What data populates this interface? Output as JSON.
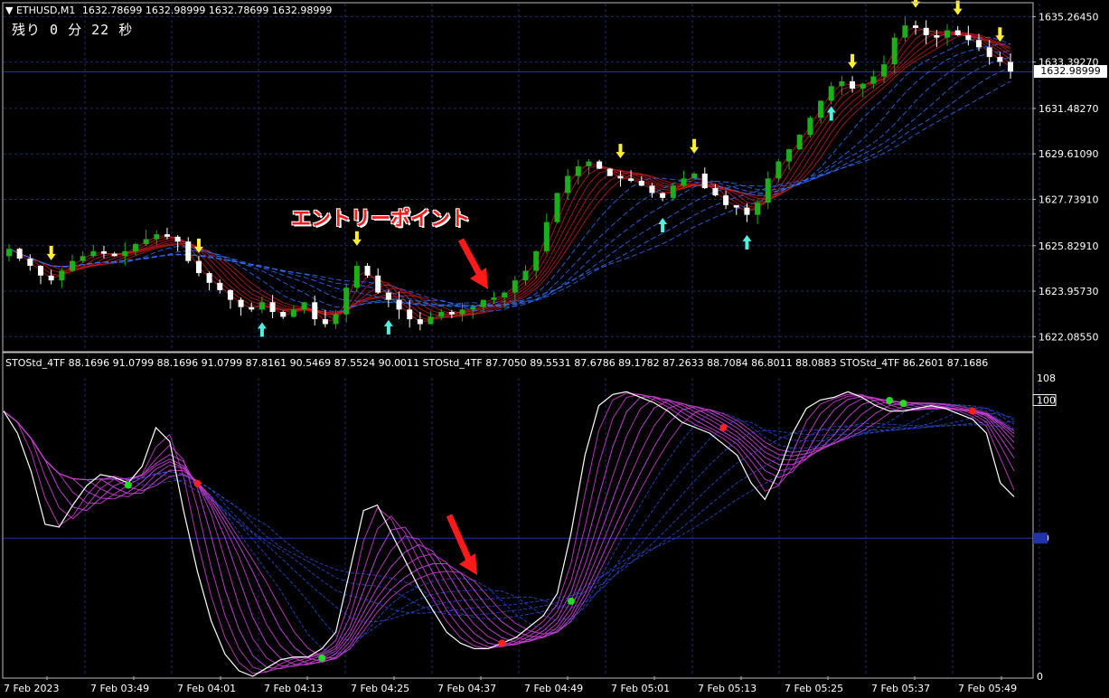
{
  "chart_header": {
    "symbol": "ETHUSD,M1",
    "ohlc": "1632.78699 1632.98999 1632.78699 1632.98999",
    "countdown": "残り 0 分 22 秒"
  },
  "annotation": "エントリーポイント",
  "current_price": "1632.98999",
  "indicator_header": "STOStd_4TF 88.1696 91.0799 88.1696 91.0799 87.8161 90.5469 87.5524 90.0011   STOStd_4TF 87.7050 89.5531 87.6786 89.1782 87.2633 88.7084 86.8011 88.0883   STOStd_4TF 86.2601 87.1686",
  "colors": {
    "background": "#000000",
    "grid": "#1c2a6e",
    "bull_candle": "#19b019",
    "bear_candle": "#ffffff",
    "ribbon_red": "#e02020",
    "ribbon_blue": "#3070ff",
    "stoch_magenta": "#d040d0",
    "stoch_blue": "#2b4bd8",
    "arrow_up": "#ffee33",
    "arrow_down": "#55eedd",
    "annotation": "#ff1a1a"
  },
  "chart_data": [
    {
      "type": "candlestick",
      "title": "ETHUSD,M1",
      "ylim": [
        1621.5,
        1635.8
      ],
      "y_ticks": [
        "1635.26450",
        "1633.39270",
        "1631.48270",
        "1629.61090",
        "1627.73910",
        "1625.82910",
        "1623.95730",
        "1622.08550"
      ],
      "y_tick_values": [
        1635.2645,
        1633.3927,
        1631.4827,
        1629.6109,
        1627.7391,
        1625.8291,
        1623.9573,
        1622.0855
      ],
      "current_price": 1632.98999,
      "close_series": [
        1625.7,
        1625.3,
        1625.0,
        1624.6,
        1624.4,
        1624.8,
        1625.2,
        1625.4,
        1625.6,
        1625.5,
        1625.4,
        1625.6,
        1625.9,
        1626.1,
        1626.3,
        1626.2,
        1626.0,
        1625.2,
        1624.7,
        1624.3,
        1624.0,
        1623.6,
        1623.3,
        1623.2,
        1623.5,
        1623.1,
        1622.9,
        1623.2,
        1623.5,
        1622.8,
        1622.6,
        1623.0,
        1624.1,
        1625.0,
        1624.6,
        1623.9,
        1623.6,
        1623.2,
        1622.8,
        1622.6,
        1622.9,
        1623.1,
        1623.0,
        1623.2,
        1623.3,
        1623.6,
        1623.7,
        1623.9,
        1624.4,
        1624.8,
        1625.6,
        1626.8,
        1628.0,
        1628.7,
        1629.1,
        1629.3,
        1629.0,
        1628.7,
        1628.6,
        1628.5,
        1628.3,
        1628.0,
        1627.8,
        1628.3,
        1628.6,
        1628.8,
        1628.2,
        1627.9,
        1627.5,
        1627.4,
        1627.1,
        1627.6,
        1628.6,
        1629.3,
        1629.8,
        1630.4,
        1631.1,
        1631.8,
        1632.4,
        1632.6,
        1632.3,
        1632.5,
        1632.8,
        1633.3,
        1634.4,
        1634.9,
        1634.8,
        1634.5,
        1634.4,
        1634.7,
        1634.5,
        1634.3,
        1634.0,
        1633.6,
        1633.4,
        1633.0
      ],
      "x_tick_labels": [
        "7 Feb 2023",
        "7 Feb 03:49",
        "7 Feb 04:01",
        "7 Feb 04:13",
        "7 Feb 04:25",
        "7 Feb 04:37",
        "7 Feb 04:49",
        "7 Feb 05:01",
        "7 Feb 05:13",
        "7 Feb 05:25",
        "7 Feb 05:37",
        "7 Feb 05:49"
      ]
    },
    {
      "type": "line",
      "title": "STOStd_4TF",
      "ylim": [
        0,
        108
      ],
      "y_ticks": [
        "108",
        "100",
        "50",
        "0"
      ],
      "y_tick_values": [
        108,
        100,
        50,
        0
      ],
      "series": [
        {
          "name": "STOStd_4TF",
          "values": [
            96,
            88,
            74,
            55,
            54,
            62,
            69,
            73,
            72,
            70,
            76,
            90,
            85,
            60,
            38,
            20,
            8,
            2,
            0,
            3,
            6,
            7,
            7,
            10,
            16,
            38,
            60,
            62,
            52,
            42,
            32,
            24,
            16,
            12,
            10,
            10,
            12,
            14,
            18,
            22,
            30,
            52,
            80,
            98,
            102,
            103,
            101,
            99,
            96,
            92,
            90,
            88,
            84,
            80,
            70,
            64,
            74,
            88,
            97,
            100,
            101,
            103,
            101,
            98,
            96,
            96,
            97,
            98,
            97,
            95,
            93,
            88,
            70,
            65
          ]
        }
      ]
    }
  ]
}
